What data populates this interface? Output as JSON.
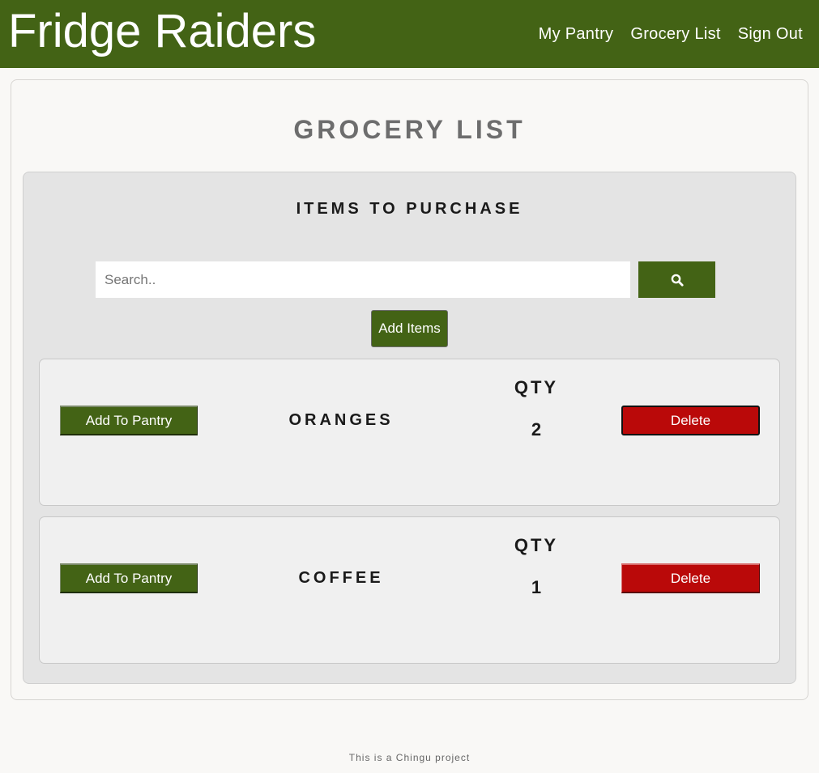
{
  "navbar": {
    "brand": "Fridge Raiders",
    "links": [
      {
        "label": "My Pantry"
      },
      {
        "label": "Grocery List"
      },
      {
        "label": "Sign Out"
      }
    ]
  },
  "page": {
    "title": "GROCERY LIST"
  },
  "panel": {
    "title": "ITEMS TO PURCHASE",
    "search_placeholder": "Search..",
    "search_icon": "search-icon",
    "add_items_label": "Add Items"
  },
  "items": [
    {
      "add_label": "Add To Pantry",
      "name": "ORANGES",
      "qty_label": "QTY",
      "qty": "2",
      "delete_label": "Delete"
    },
    {
      "add_label": "Add To Pantry",
      "name": "COFFEE",
      "qty_label": "QTY",
      "qty": "1",
      "delete_label": "Delete"
    }
  ],
  "footer": {
    "text": "This is a Chingu project"
  },
  "colors": {
    "brand_green": "#436315",
    "delete_red": "#ba0909",
    "page_bg": "#f9f8f6",
    "panel_bg": "#e4e4e4"
  }
}
